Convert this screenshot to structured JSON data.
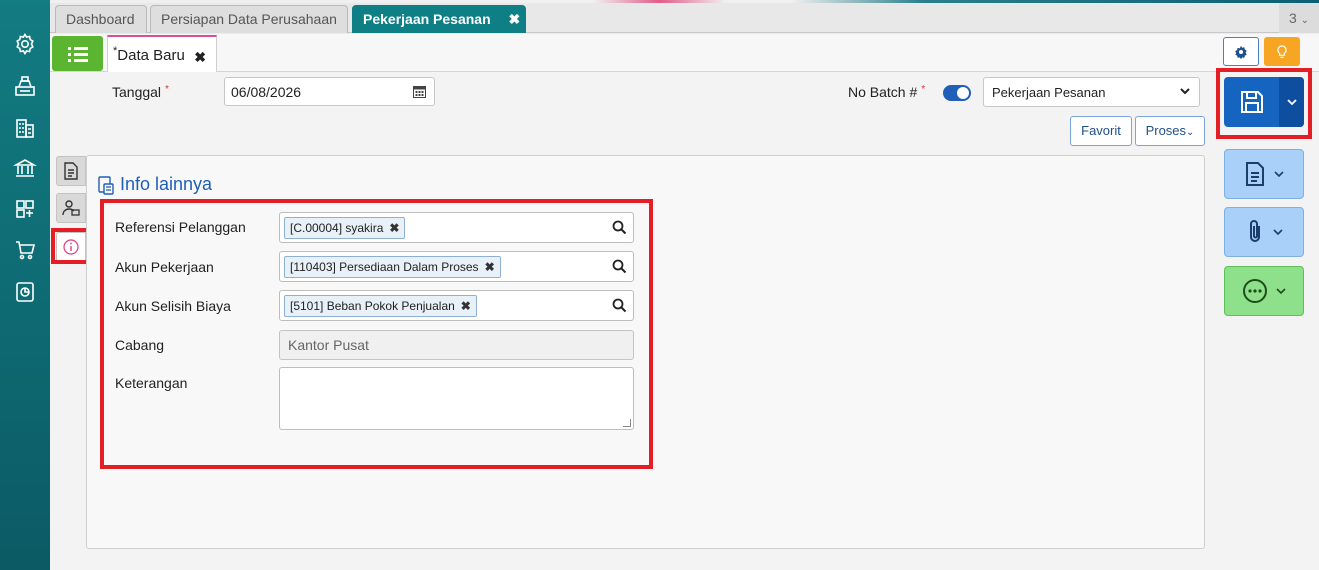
{
  "tabs": {
    "items": [
      {
        "label": "Dashboard"
      },
      {
        "label": "Persiapan Data Perusahaan"
      },
      {
        "label": "Pekerjaan Pesanan"
      }
    ],
    "close_glyph": "✖",
    "count": "3"
  },
  "subtab": {
    "marker": "*",
    "label": "Data Baru",
    "close_glyph": "✖"
  },
  "form": {
    "tanggal_label": "Tanggal",
    "tanggal_value": "06/08/2026",
    "required_mark": "*",
    "nobatch_label": "No Batch #",
    "nobatch_toggle": true,
    "nobatch_select": "Pekerjaan Pesanan",
    "favorit_label": "Favorit",
    "proses_label": "Proses"
  },
  "section": {
    "title": "Info lainnya",
    "fields": {
      "referensi_label": "Referensi Pelanggan",
      "referensi_tag": "[C.00004] syakira",
      "akun_pekerjaan_label": "Akun Pekerjaan",
      "akun_pekerjaan_tag": "[110403] Persediaan Dalam Proses",
      "akun_selisih_label": "Akun Selisih Biaya",
      "akun_selisih_tag": "[5101] Beban Pokok Penjualan",
      "cabang_label": "Cabang",
      "cabang_value": "Kantor Pusat",
      "keterangan_label": "Keterangan",
      "keterangan_value": ""
    },
    "tag_remove_glyph": "✖"
  },
  "icons": {
    "nav": [
      "gear-icon",
      "cash-register-icon",
      "building-icon",
      "bank-icon",
      "inventory-icon",
      "cart-icon",
      "report-chart-icon"
    ],
    "side_tabs": [
      "document-icon",
      "user-money-icon",
      "info-icon"
    ],
    "right_actions": [
      "save-icon",
      "document-icon",
      "paperclip-icon",
      "more-icon"
    ]
  },
  "colors": {
    "teal": "#0f7f86",
    "green": "#5cb531",
    "save_blue": "#1565c0",
    "light_blue": "#a8d0f8",
    "light_green": "#8fe08a",
    "orange": "#f6a623",
    "highlight_red": "#e31e24"
  }
}
